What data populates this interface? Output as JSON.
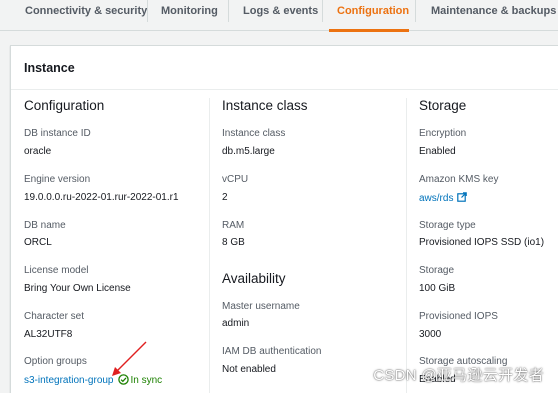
{
  "tabs": [
    {
      "label": "Connectivity & security",
      "active": false
    },
    {
      "label": "Monitoring",
      "active": false
    },
    {
      "label": "Logs & events",
      "active": false
    },
    {
      "label": "Configuration",
      "active": true
    },
    {
      "label": "Maintenance & backups",
      "active": false
    }
  ],
  "panel": {
    "title": "Instance"
  },
  "configuration": {
    "title": "Configuration",
    "fields": [
      {
        "label": "DB instance ID",
        "value": "oracle"
      },
      {
        "label": "Engine version",
        "value": "19.0.0.0.ru-2022-01.rur-2022-01.r1"
      },
      {
        "label": "DB name",
        "value": "ORCL"
      },
      {
        "label": "License model",
        "value": "Bring Your Own License"
      },
      {
        "label": "Character set",
        "value": "AL32UTF8"
      },
      {
        "label": "Option groups",
        "value": "s3-integration-group",
        "status": "In sync"
      }
    ]
  },
  "instance_class": {
    "title": "Instance class",
    "fields": [
      {
        "label": "Instance class",
        "value": "db.m5.large"
      },
      {
        "label": "vCPU",
        "value": "2"
      },
      {
        "label": "RAM",
        "value": "8 GB"
      }
    ]
  },
  "availability": {
    "title": "Availability",
    "fields": [
      {
        "label": "Master username",
        "value": "admin"
      },
      {
        "label": "IAM DB authentication",
        "value": "Not enabled"
      }
    ]
  },
  "storage": {
    "title": "Storage",
    "fields": [
      {
        "label": "Encryption",
        "value": "Enabled"
      },
      {
        "label": "Amazon KMS key",
        "value": "aws/rds"
      },
      {
        "label": "Storage type",
        "value": "Provisioned IOPS SSD (io1)"
      },
      {
        "label": "Storage",
        "value": "100 GiB"
      },
      {
        "label": "Provisioned IOPS",
        "value": "3000"
      },
      {
        "label": "Storage autoscaling",
        "value": "Enabled"
      }
    ]
  },
  "watermark": "CSDN @亚马逊云开发者",
  "colors": {
    "accent": "#ec7211",
    "link": "#0073bb",
    "success": "#1d8102",
    "annotation_arrow": "#e02020"
  }
}
